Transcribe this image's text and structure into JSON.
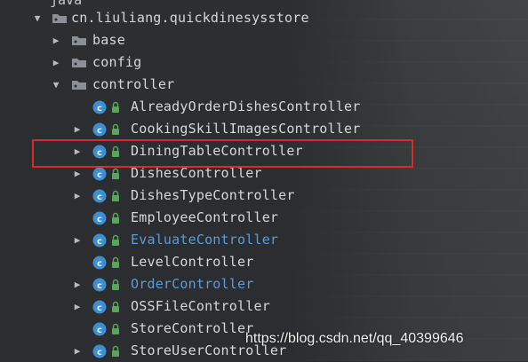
{
  "tree": {
    "top_cut_label": "java",
    "package": "cn.liuliang.quickdinesysstore",
    "folders": {
      "base": "base",
      "config": "config",
      "controller": "controller"
    },
    "classes": [
      {
        "label": "AlreadyOrderDishesController",
        "expandable": false,
        "highlight": false
      },
      {
        "label": "CookingSkillImagesController",
        "expandable": true,
        "highlight": false
      },
      {
        "label": "DiningTableController",
        "expandable": true,
        "highlight": false
      },
      {
        "label": "DishesController",
        "expandable": true,
        "highlight": false
      },
      {
        "label": "DishesTypeController",
        "expandable": true,
        "highlight": false
      },
      {
        "label": "EmployeeController",
        "expandable": false,
        "highlight": false
      },
      {
        "label": "EvaluateController",
        "expandable": true,
        "highlight": true
      },
      {
        "label": "LevelController",
        "expandable": false,
        "highlight": false
      },
      {
        "label": "OrderController",
        "expandable": true,
        "highlight": true
      },
      {
        "label": "OSSFileController",
        "expandable": true,
        "highlight": false
      },
      {
        "label": "StoreController",
        "expandable": false,
        "highlight": false
      },
      {
        "label": "StoreUserController",
        "expandable": true,
        "highlight": false
      }
    ]
  },
  "icons": {
    "expanded": "chevron-down-icon",
    "collapsed": "chevron-right-icon",
    "folder": "package-folder-icon",
    "class": "class-icon"
  },
  "colors": {
    "background": "#2b2d30",
    "text": "#d5d7da",
    "highlight_text": "#5e9bd8",
    "class_icon": "#3d8fd1",
    "lock_icon": "#58a55c",
    "selection_border": "#d92b2b"
  },
  "watermark": "https://blog.csdn.net/qq_40399646"
}
